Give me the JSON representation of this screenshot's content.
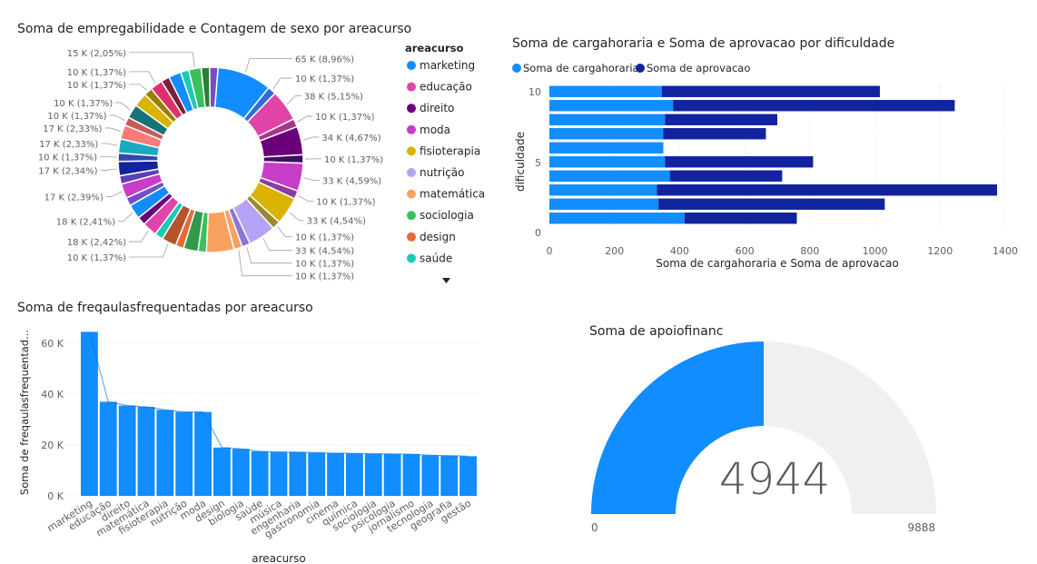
{
  "chart_data": [
    {
      "id": "donut",
      "type": "pie",
      "title": "Soma de empregabilidade e Contagem de sexo por areacurso",
      "legend_title": "areacurso",
      "legend_position": "right",
      "legend_items": [
        {
          "name": "marketing",
          "color": "#118DFF"
        },
        {
          "name": "educação",
          "color": "#E044A7"
        },
        {
          "name": "direito",
          "color": "#6B007B"
        },
        {
          "name": "moda",
          "color": "#C83DC8"
        },
        {
          "name": "fisioterapia",
          "color": "#D9B300"
        },
        {
          "name": "nutrição",
          "color": "#B6A3F6"
        },
        {
          "name": "matemática",
          "color": "#F8A05E"
        },
        {
          "name": "sociologia",
          "color": "#3CC05C"
        },
        {
          "name": "design",
          "color": "#E66C37"
        },
        {
          "name": "saúde",
          "color": "#1ACAB5"
        }
      ],
      "slices": [
        {
          "label": "65 K (8,96%)",
          "value": 8.96,
          "color": "#118DFF"
        },
        {
          "label": "10 K (1,37%)",
          "value": 1.37,
          "color": "#2D6FD6"
        },
        {
          "label": "38 K (5,15%)",
          "value": 5.15,
          "color": "#E044A7"
        },
        {
          "label": "10 K (1,37%)",
          "value": 1.37,
          "color": "#A83687"
        },
        {
          "label": "34 K (4,67%)",
          "value": 4.67,
          "color": "#6B007B"
        },
        {
          "label": "10 K (1,37%)",
          "value": 1.37,
          "color": "#420E6A"
        },
        {
          "label": "33 K (4,59%)",
          "value": 4.59,
          "color": "#C83DC8"
        },
        {
          "label": "10 K (1,37%)",
          "value": 1.37,
          "color": "#8E3BA3"
        },
        {
          "label": "33 K (4,54%)",
          "value": 4.54,
          "color": "#D9B300"
        },
        {
          "label": "10 K (1,37%)",
          "value": 1.37,
          "color": "#9B8A2A"
        },
        {
          "label": "33 K (4,54%)",
          "value": 4.54,
          "color": "#B6A3F6"
        },
        {
          "label": "10 K (1,37%)",
          "value": 1.37,
          "color": "#8C76D6"
        },
        {
          "label": "10 K (1,37%)",
          "value": 1.37,
          "color": "#F8A05E"
        },
        {
          "label": "",
          "value": 4.54,
          "color": "#F8A05E"
        },
        {
          "label": "",
          "value": 1.37,
          "color": "#3CC05C"
        },
        {
          "label": "",
          "value": 2.4,
          "color": "#2E9A4A"
        },
        {
          "label": "",
          "value": 1.37,
          "color": "#E66C37"
        },
        {
          "label": "10 K (1,37%)",
          "value": 2.4,
          "color": "#B5532B"
        },
        {
          "label": "",
          "value": 1.37,
          "color": "#1ACAB5"
        },
        {
          "label": "18 K (2,42%)",
          "value": 2.42,
          "color": "#E044A7"
        },
        {
          "label": "",
          "value": 1.37,
          "color": "#6B007B"
        },
        {
          "label": "18 K (2,41%)",
          "value": 2.41,
          "color": "#118DFF"
        },
        {
          "label": "",
          "value": 1.37,
          "color": "#744EC2"
        },
        {
          "label": "17 K (2,39%)",
          "value": 2.39,
          "color": "#C83DC8"
        },
        {
          "label": "",
          "value": 1.37,
          "color": "#5D3FB4"
        },
        {
          "label": "17 K (2,34%)",
          "value": 2.34,
          "color": "#12239E"
        },
        {
          "label": "10 K (1,37%)",
          "value": 1.37,
          "color": "#3049AD"
        },
        {
          "label": "17 K (2,33%)",
          "value": 2.33,
          "color": "#1AAAC0"
        },
        {
          "label": "17 K (2,33%)",
          "value": 2.33,
          "color": "#FF7A7A"
        },
        {
          "label": "10 K (1,37%)",
          "value": 1.37,
          "color": "#C85A5A"
        },
        {
          "label": "10 K (1,37%)",
          "value": 2.3,
          "color": "#197278"
        },
        {
          "label": "",
          "value": 2.3,
          "color": "#D9B300"
        },
        {
          "label": "10 K (1,37%)",
          "value": 1.37,
          "color": "#9B7E00"
        },
        {
          "label": "10 K (1,37%)",
          "value": 2.05,
          "color": "#E0306A"
        },
        {
          "label": "",
          "value": 1.37,
          "color": "#7A1F3D"
        },
        {
          "label": "",
          "value": 2.05,
          "color": "#118DFF"
        },
        {
          "label": "",
          "value": 1.37,
          "color": "#1ACAB5"
        },
        {
          "label": "15 K (2,05%)",
          "value": 2.05,
          "color": "#3CC05C"
        },
        {
          "label": "",
          "value": 1.37,
          "color": "#2E7D32"
        },
        {
          "label": "",
          "value": 1.37,
          "color": "#744EC2"
        }
      ]
    },
    {
      "id": "hbar",
      "type": "bar",
      "orientation": "horizontal",
      "stacked": true,
      "title": "Soma de cargahoraria e Soma de aprovacao por dificuldade",
      "xlabel": "Soma de cargahoraria e Soma de aprovacao",
      "ylabel": "dificuldade",
      "xlim": [
        0,
        1400
      ],
      "xticks": [
        "0",
        "200",
        "400",
        "600",
        "800",
        "1000",
        "1200",
        "1400"
      ],
      "ylim": [
        0,
        10
      ],
      "yticks": [
        "10",
        "5",
        "0"
      ],
      "legend_position": "top-left",
      "grid": true,
      "categories": [
        "10",
        "9",
        "8",
        "7",
        "6",
        "5",
        "4",
        "3",
        "2",
        "1"
      ],
      "series": [
        {
          "name": "Soma de cargahoraria",
          "color": "#118DFF",
          "values": [
            345,
            380,
            355,
            350,
            350,
            355,
            370,
            330,
            335,
            415
          ]
        },
        {
          "name": "Soma de aprovacao",
          "color": "#12239E",
          "values": [
            670,
            865,
            345,
            315,
            0,
            455,
            345,
            1045,
            695,
            345
          ]
        }
      ]
    },
    {
      "id": "area",
      "type": "bar",
      "title": "Soma de freqaulasfrequentadas por areacurso",
      "xlabel": "areacurso",
      "ylabel": "Soma de freqaulasfrequentad...",
      "ylim": [
        0,
        70000
      ],
      "yticks": [
        "60 K",
        "40 K",
        "20 K",
        "0 K"
      ],
      "grid": true,
      "color": "#118DFF",
      "categories": [
        "marketing",
        "educação",
        "direito",
        "matemática",
        "fisioterapia",
        "nutrição",
        "moda",
        "design",
        "biologia",
        "saúde",
        "música",
        "engenharia",
        "gastronomia",
        "cinema",
        "química",
        "sociologia",
        "psicologia",
        "jornalismo",
        "tecnologia",
        "geografia",
        "gestão"
      ],
      "values": [
        64500,
        37000,
        35500,
        35000,
        33800,
        33000,
        33000,
        19000,
        18500,
        17500,
        17300,
        17200,
        17000,
        16800,
        16700,
        16600,
        16500,
        16400,
        16000,
        15800,
        15600
      ]
    },
    {
      "id": "gauge",
      "type": "gauge",
      "title": "Soma de apoiofinanc",
      "value": 4944,
      "value_label": "4944",
      "min_label": "0",
      "max_label": "9888",
      "fill_fraction": 0.5,
      "fill_color": "#118DFF",
      "track_color": "#F0F0F0"
    }
  ]
}
